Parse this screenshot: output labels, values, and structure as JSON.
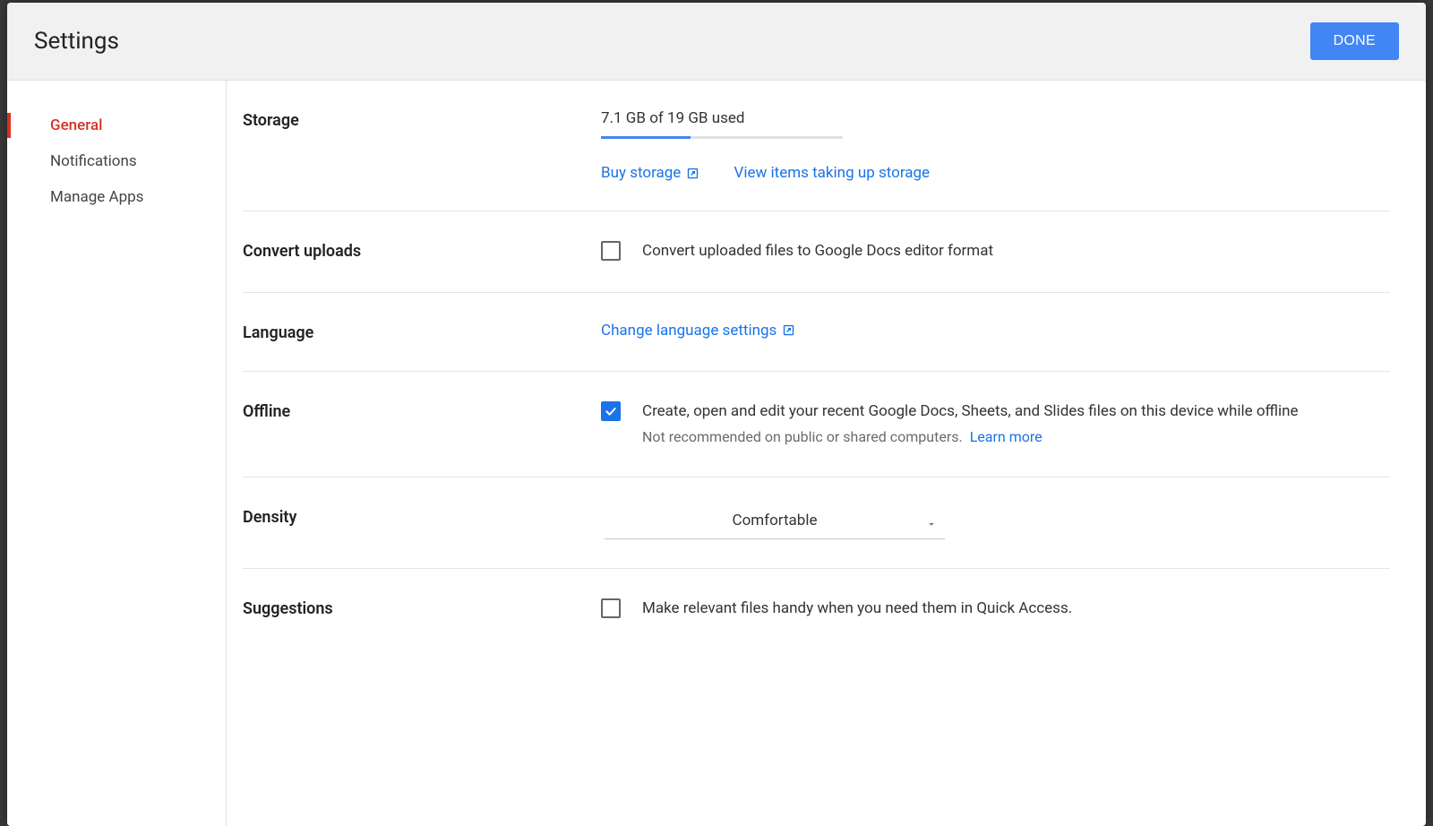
{
  "header": {
    "title": "Settings",
    "done_label": "DONE"
  },
  "sidebar": {
    "items": [
      {
        "label": "General",
        "active": true
      },
      {
        "label": "Notifications",
        "active": false
      },
      {
        "label": "Manage Apps",
        "active": false
      }
    ]
  },
  "storage": {
    "label": "Storage",
    "summary": "7.1 GB of 19 GB used",
    "percent": 37,
    "buy_label": "Buy storage",
    "view_label": "View items taking up storage"
  },
  "convert": {
    "label": "Convert uploads",
    "checked": false,
    "text": "Convert uploaded files to Google Docs editor format"
  },
  "language": {
    "label": "Language",
    "link": "Change language settings"
  },
  "offline": {
    "label": "Offline",
    "checked": true,
    "text": "Create, open and edit your recent Google Docs, Sheets, and Slides files on this device while offline",
    "hint": "Not recommended on public or shared computers.",
    "learn_more": "Learn more"
  },
  "density": {
    "label": "Density",
    "value": "Comfortable"
  },
  "suggestions": {
    "label": "Suggestions",
    "checked": false,
    "text": "Make relevant files handy when you need them in Quick Access."
  }
}
